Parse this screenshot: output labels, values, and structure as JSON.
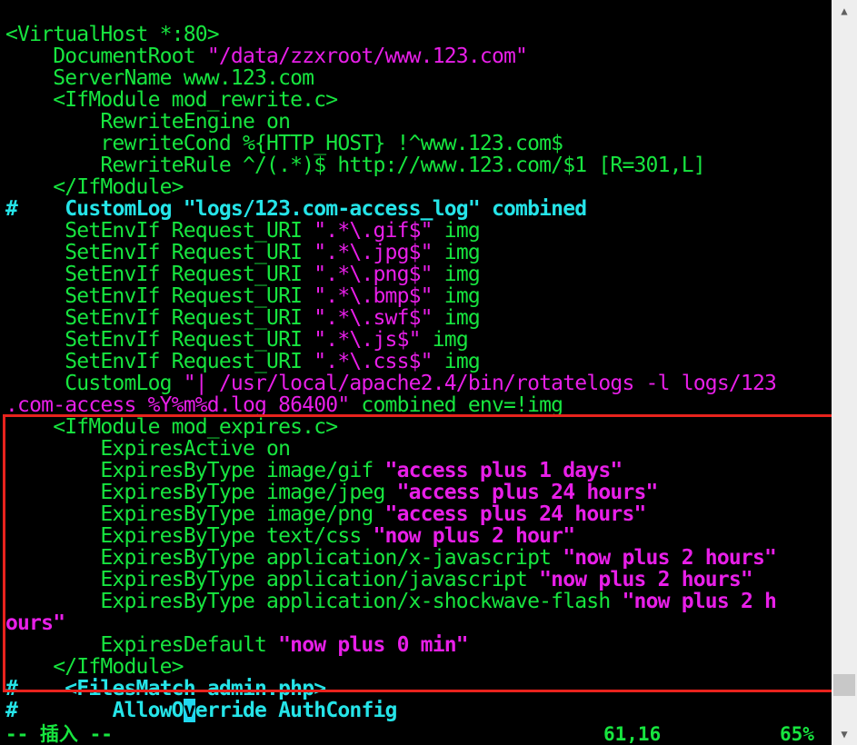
{
  "editor": {
    "lines": [
      {
        "segments": [
          {
            "t": "<VirtualHost *:80>",
            "c": "g"
          }
        ]
      },
      {
        "segments": [
          {
            "t": "    DocumentRoot ",
            "c": "g"
          },
          {
            "t": "\"/data/zzxroot/www.123.com\"",
            "c": "m"
          }
        ]
      },
      {
        "segments": [
          {
            "t": "    ServerName www.123.com",
            "c": "g"
          }
        ]
      },
      {
        "segments": [
          {
            "t": "    <IfModule mod_rewrite.c>",
            "c": "g"
          }
        ]
      },
      {
        "segments": [
          {
            "t": "        RewriteEngine on",
            "c": "g"
          }
        ]
      },
      {
        "segments": [
          {
            "t": "        rewriteCond %{HTTP_HOST} !^www.123.com$",
            "c": "g"
          }
        ]
      },
      {
        "segments": [
          {
            "t": "        RewriteRule ^/(.*)$ http://www.123.com/$1 [R=301,L]",
            "c": "g"
          }
        ]
      },
      {
        "segments": [
          {
            "t": "    </IfModule>",
            "c": "g"
          }
        ]
      },
      {
        "segments": [
          {
            "t": "#    ",
            "c": "cb"
          },
          {
            "t": "CustomLog \"logs/123.com-access_log\" combined",
            "c": "cb"
          }
        ]
      },
      {
        "segments": [
          {
            "t": "     SetEnvIf Request_URI ",
            "c": "g"
          },
          {
            "t": "\".*\\.gif$\"",
            "c": "m"
          },
          {
            "t": " img",
            "c": "g"
          }
        ]
      },
      {
        "segments": [
          {
            "t": "     SetEnvIf Request_URI ",
            "c": "g"
          },
          {
            "t": "\".*\\.jpg$\"",
            "c": "m"
          },
          {
            "t": " img",
            "c": "g"
          }
        ]
      },
      {
        "segments": [
          {
            "t": "     SetEnvIf Request_URI ",
            "c": "g"
          },
          {
            "t": "\".*\\.png$\"",
            "c": "m"
          },
          {
            "t": " img",
            "c": "g"
          }
        ]
      },
      {
        "segments": [
          {
            "t": "     SetEnvIf Request_URI ",
            "c": "g"
          },
          {
            "t": "\".*\\.bmp$\"",
            "c": "m"
          },
          {
            "t": " img",
            "c": "g"
          }
        ]
      },
      {
        "segments": [
          {
            "t": "     SetEnvIf Request_URI ",
            "c": "g"
          },
          {
            "t": "\".*\\.swf$\"",
            "c": "m"
          },
          {
            "t": " img",
            "c": "g"
          }
        ]
      },
      {
        "segments": [
          {
            "t": "     SetEnvIf Request_URI ",
            "c": "g"
          },
          {
            "t": "\".*\\.js$\"",
            "c": "m"
          },
          {
            "t": " img",
            "c": "g"
          }
        ]
      },
      {
        "segments": [
          {
            "t": "     SetEnvIf Request_URI ",
            "c": "g"
          },
          {
            "t": "\".*\\.css$\"",
            "c": "m"
          },
          {
            "t": " img",
            "c": "g"
          }
        ]
      },
      {
        "segments": [
          {
            "t": "     CustomLog ",
            "c": "g"
          },
          {
            "t": "\"| /usr/local/apache2.4/bin/rotatelogs -l logs/123",
            "c": "m"
          }
        ]
      },
      {
        "segments": [
          {
            "t": ".com-access_%Y%m%d.log 86400\"",
            "c": "m"
          },
          {
            "t": " combined env=!img",
            "c": "g"
          }
        ]
      },
      {
        "segments": [
          {
            "t": "    <IfModule mod_expires.c>",
            "c": "g"
          }
        ]
      },
      {
        "segments": [
          {
            "t": "        ExpiresActive on",
            "c": "g"
          }
        ]
      },
      {
        "segments": [
          {
            "t": "        ExpiresByType image/gif ",
            "c": "g"
          },
          {
            "t": "\"access plus 1 days\"",
            "c": "mb"
          }
        ]
      },
      {
        "segments": [
          {
            "t": "        ExpiresByType image/jpeg ",
            "c": "g"
          },
          {
            "t": "\"access plus 24 hours\"",
            "c": "mb"
          }
        ]
      },
      {
        "segments": [
          {
            "t": "        ExpiresByType image/png ",
            "c": "g"
          },
          {
            "t": "\"access plus 24 hours\"",
            "c": "mb"
          }
        ]
      },
      {
        "segments": [
          {
            "t": "        ExpiresByType text/css ",
            "c": "g"
          },
          {
            "t": "\"now plus 2 hour\"",
            "c": "mb"
          }
        ]
      },
      {
        "segments": [
          {
            "t": "        ExpiresByType application/x-javascript ",
            "c": "g"
          },
          {
            "t": "\"now plus 2 hours\"",
            "c": "mb"
          }
        ]
      },
      {
        "segments": [
          {
            "t": "        ExpiresByType application/javascript ",
            "c": "g"
          },
          {
            "t": "\"now plus 2 hours\"",
            "c": "mb"
          }
        ]
      },
      {
        "segments": [
          {
            "t": "        ExpiresByType application/x-shockwave-flash ",
            "c": "g"
          },
          {
            "t": "\"now plus 2 h",
            "c": "mb"
          }
        ]
      },
      {
        "segments": [
          {
            "t": "ours\"",
            "c": "mb"
          }
        ]
      },
      {
        "segments": [
          {
            "t": "        ExpiresDefault ",
            "c": "g"
          },
          {
            "t": "\"now plus 0 min\"",
            "c": "mb"
          }
        ]
      },
      {
        "segments": [
          {
            "t": "    </IfModule>",
            "c": "g"
          }
        ]
      },
      {
        "segments": [
          {
            "t": "#    ",
            "c": "cb"
          },
          {
            "t": "<FilesMatch admin.php>",
            "c": "cb"
          }
        ]
      },
      {
        "segments": [
          {
            "t": "#        ",
            "c": "cb"
          },
          {
            "t": "AllowO",
            "c": "cb"
          },
          {
            "t": "v",
            "c": "cursor"
          },
          {
            "t": "erride AuthConfig",
            "c": "cb"
          }
        ]
      }
    ]
  },
  "status": {
    "mode": "-- 插入 --",
    "position": "61,16",
    "percent": "65%"
  },
  "colors": {
    "background": "#000000",
    "keyword_green": "#17e53f",
    "string_magenta": "#e81fe8",
    "comment_cyan": "#25e4e8",
    "highlight_red": "#e8231d"
  },
  "icons": {
    "scroll_up": "triangle-up-icon",
    "scroll_down": "triangle-down-icon"
  }
}
